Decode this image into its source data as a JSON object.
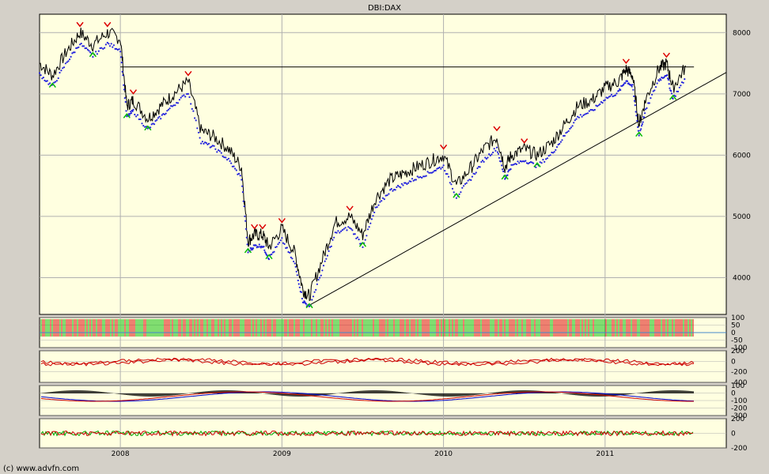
{
  "title": "DBI:DAX",
  "copyright": "(c) www.advfn.com",
  "colors": {
    "panel_bg": "#ffffe0",
    "frame_bg": "#d4d0c8",
    "price": "#000000",
    "sar": "#2222dd",
    "sell_marker": "#dd0000",
    "buy_marker": "#00bb00",
    "grid": "#b0b0b0",
    "indicator_red": "#cc0000",
    "indicator_blue": "#0000cc",
    "indicator_green": "#00aa00"
  },
  "chart_data": [
    {
      "type": "line",
      "panel": "price",
      "title": "DBI:DAX",
      "x_ticks": [
        "2008",
        "2009",
        "2010",
        "2011"
      ],
      "y_ticks": [
        "8000",
        "7000",
        "6000",
        "5000",
        "4000"
      ],
      "ylim": [
        3400,
        8300
      ],
      "xlim": [
        2007.5,
        2011.75
      ],
      "grid": true,
      "series": [
        {
          "kind": "price",
          "x": [
            2007.5,
            2007.58,
            2007.67,
            2007.75,
            2007.83,
            2007.92,
            2008.0,
            2008.04,
            2008.08,
            2008.17,
            2008.25,
            2008.33,
            2008.42,
            2008.5,
            2008.58,
            2008.67,
            2008.75,
            2008.79,
            2008.83,
            2008.88,
            2008.92,
            2009.0,
            2009.08,
            2009.13,
            2009.17,
            2009.25,
            2009.33,
            2009.42,
            2009.5,
            2009.58,
            2009.67,
            2009.75,
            2009.83,
            2009.92,
            2010.0,
            2010.08,
            2010.17,
            2010.25,
            2010.33,
            2010.38,
            2010.42,
            2010.5,
            2010.58,
            2010.67,
            2010.75,
            2010.83,
            2010.92,
            2011.0,
            2011.08,
            2011.13,
            2011.17,
            2011.21,
            2011.25,
            2011.33,
            2011.38,
            2011.42,
            2011.5
          ],
          "y": [
            7500,
            7300,
            7700,
            8000,
            7800,
            8000,
            7900,
            6800,
            6900,
            6600,
            6800,
            7000,
            7200,
            6400,
            6300,
            6100,
            5800,
            4600,
            4700,
            4700,
            4500,
            4800,
            4400,
            3800,
            3700,
            4300,
            4900,
            5000,
            4700,
            5300,
            5600,
            5700,
            5800,
            5900,
            6000,
            5500,
            5800,
            6100,
            6300,
            5800,
            6000,
            6100,
            6000,
            6200,
            6500,
            6800,
            6900,
            7100,
            7200,
            7400,
            7300,
            6500,
            6900,
            7400,
            7500,
            7100,
            7450
          ]
        }
      ],
      "reference_line": 7440,
      "trendline": [
        [
          2009.17,
          3550
        ],
        [
          2011.75,
          7350
        ]
      ]
    },
    {
      "type": "bar",
      "panel": "indicator-1",
      "y_ticks": [
        "100",
        "50",
        "0",
        "-50",
        "-100"
      ],
      "ylim": [
        -100,
        100
      ]
    },
    {
      "type": "line",
      "panel": "indicator-2",
      "y_ticks": [
        "200",
        "0",
        "-200",
        "-400"
      ],
      "ylim": [
        -400,
        200
      ]
    },
    {
      "type": "line",
      "panel": "indicator-3",
      "y_ticks": [
        "100",
        "0",
        "-100",
        "-200",
        "-300"
      ],
      "ylim": [
        -300,
        100
      ]
    },
    {
      "type": "line",
      "panel": "indicator-4",
      "y_ticks": [
        "200",
        "0",
        "-200"
      ],
      "ylim": [
        -200,
        200
      ]
    }
  ]
}
